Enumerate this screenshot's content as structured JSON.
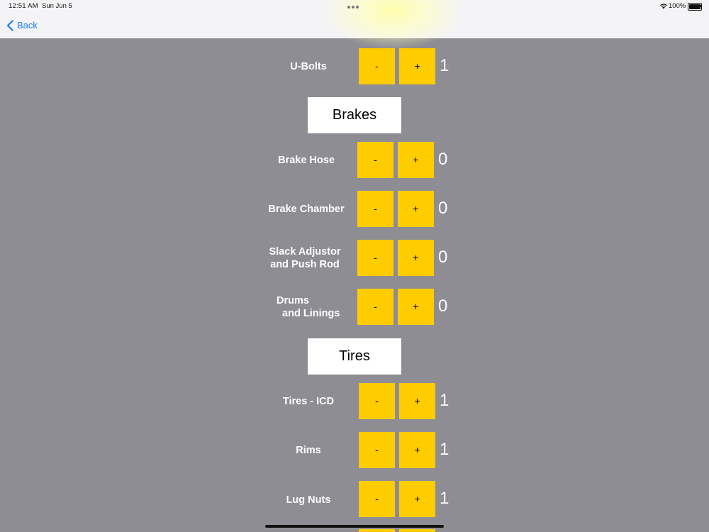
{
  "status_bar": {
    "time": "12:51 AM",
    "date": "Sun Jun 5",
    "battery": "100%"
  },
  "nav": {
    "back_label": "Back"
  },
  "colors": {
    "background": "#8e8d93",
    "button": "#ffcc00",
    "link": "#1b7cf5"
  },
  "buttons": {
    "minus": "-",
    "plus": "+"
  },
  "items": [
    {
      "label": "U-Bolts",
      "count": "1"
    },
    {
      "label": "Brake Hose",
      "count": "0"
    },
    {
      "label": "Brake Chamber",
      "count": "0"
    },
    {
      "label": "Slack Adjustor\nand Push Rod",
      "count": "0"
    },
    {
      "label": "Drums\n  and Linings",
      "count": "0"
    },
    {
      "label": "Tires - ICD",
      "count": "1"
    },
    {
      "label": "Rims",
      "count": "1"
    },
    {
      "label": "Lug Nuts",
      "count": "1"
    }
  ],
  "sections": [
    {
      "title": "Brakes"
    },
    {
      "title": "Tires"
    }
  ]
}
